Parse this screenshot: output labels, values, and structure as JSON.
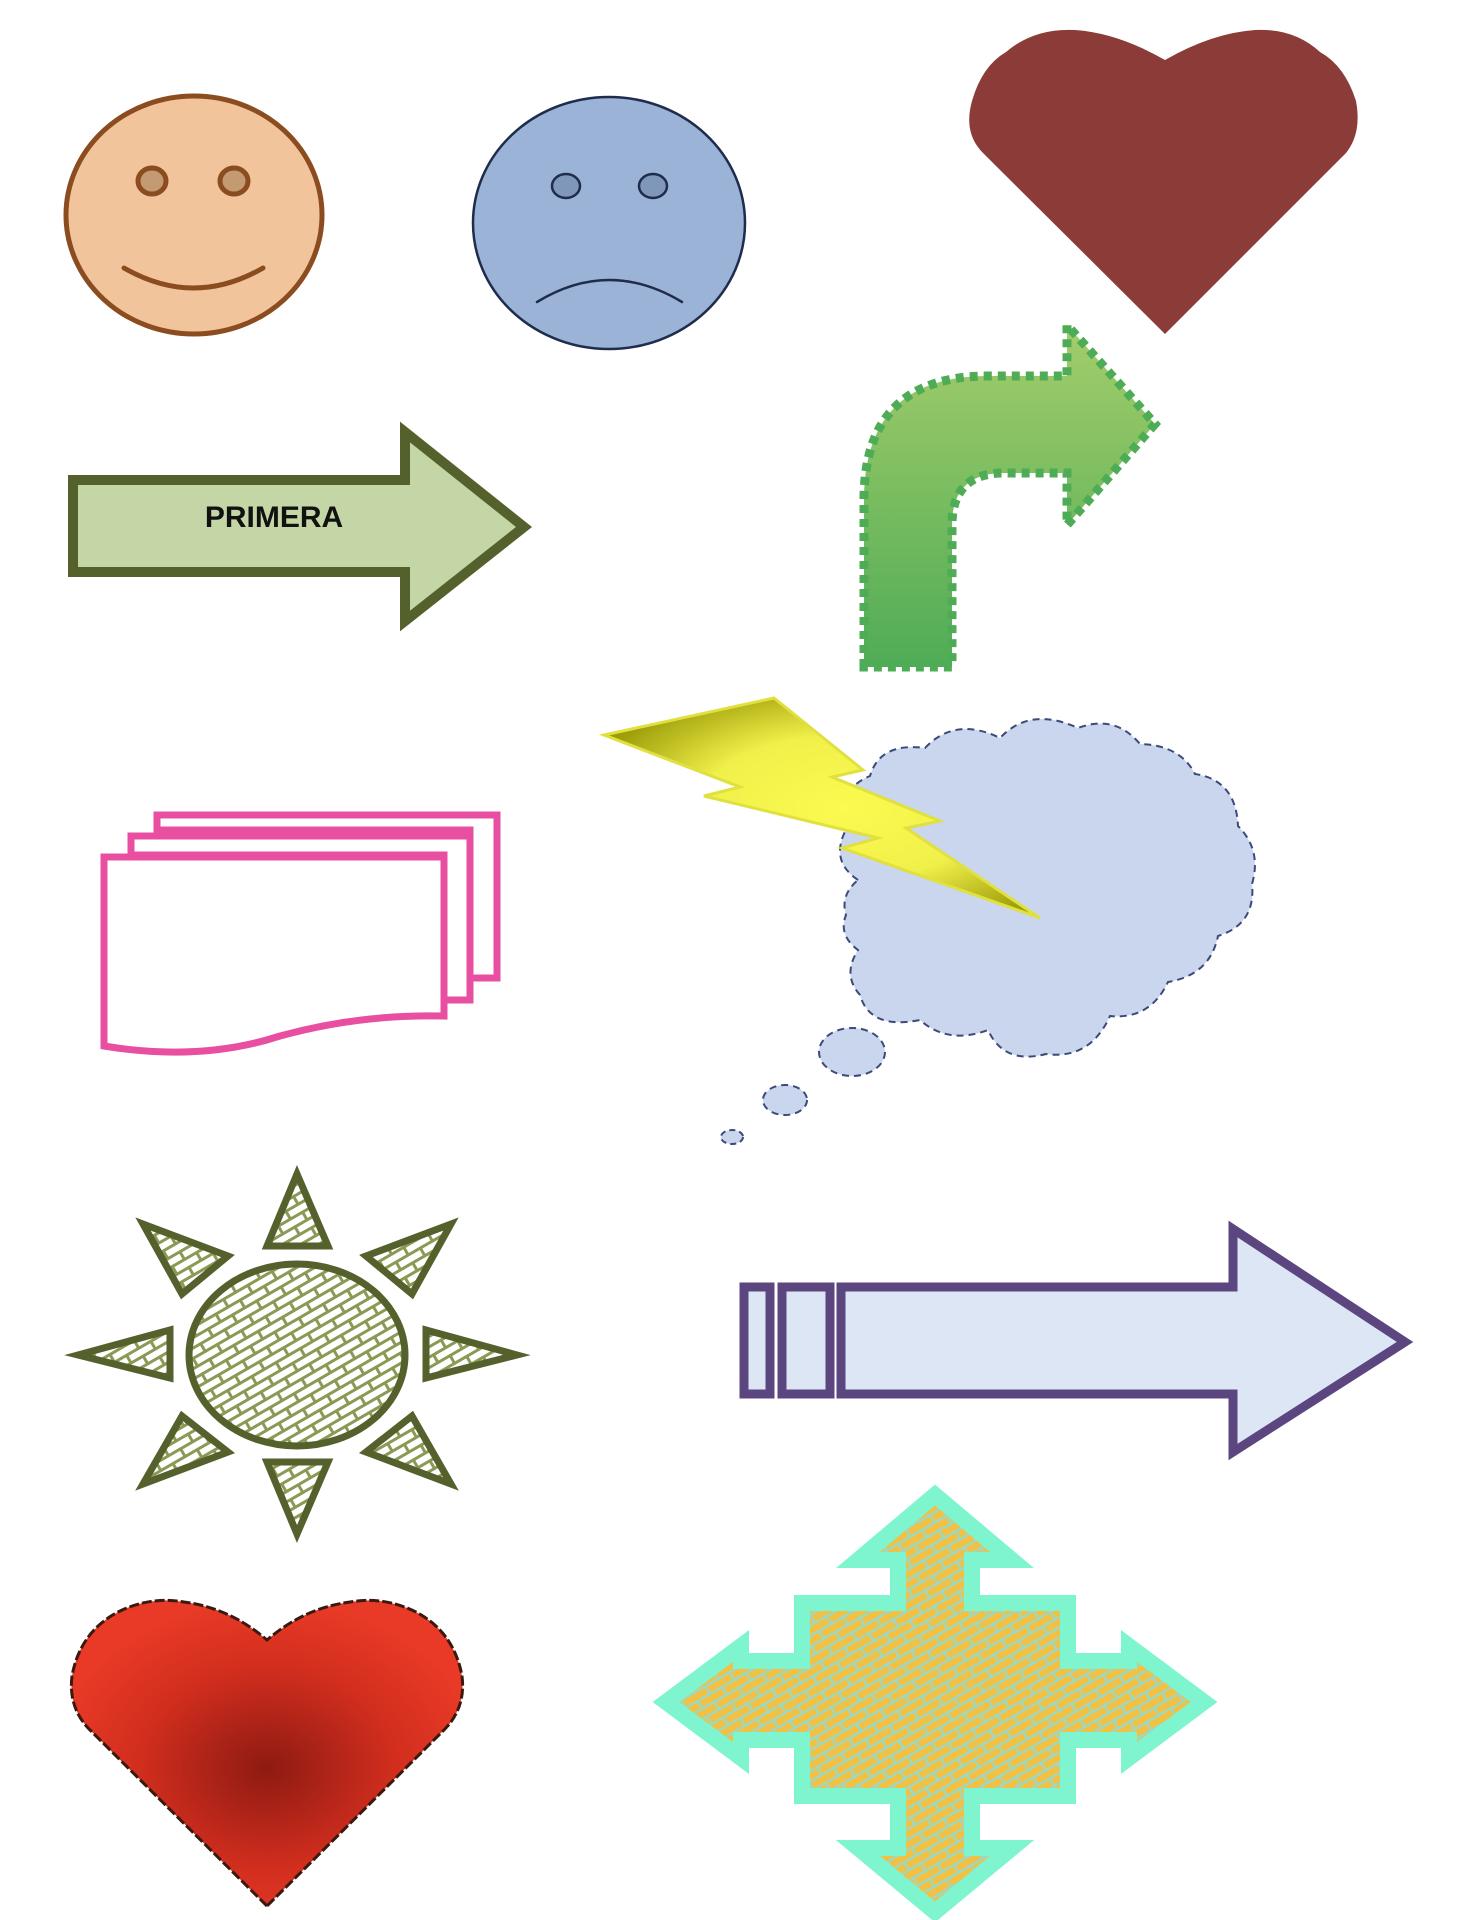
{
  "page": {
    "background": "#ffffff"
  },
  "shapes": {
    "smiley_face": {
      "fill": "#f2c49b",
      "stroke": "#8b4c1f"
    },
    "sad_face": {
      "fill": "#9bb3d6",
      "stroke": "#1f2c4c"
    },
    "heart_dark": {
      "fill": "#8b3c38"
    },
    "block_arrow_right": {
      "label": "PRIMERA",
      "fill": "#c5d6a6",
      "stroke": "#55612d"
    },
    "bent_arrow": {
      "fill_top": "#a4cd6a",
      "fill_bottom": "#4fac56",
      "stroke": "#4fac56"
    },
    "lightning_bolt": {
      "fill_light": "#fafa50",
      "fill_dark": "#b8b80c",
      "stroke": "#e0e040"
    },
    "thought_cloud": {
      "fill": "#c9d6ee",
      "stroke": "#3b4a7a"
    },
    "multidocument": {
      "stroke": "#e84fa0",
      "fill": "#ffffff"
    },
    "sun": {
      "stroke": "#55612d",
      "pattern": "#8a9a55"
    },
    "striped_arrow": {
      "fill": "#dce6f4",
      "stroke": "#5b4680"
    },
    "heart_red": {
      "fill_outer": "#e83a26",
      "fill_center": "#8e1a12",
      "stroke": "#3a1a10"
    },
    "quad_arrow": {
      "fill": "#f2c042",
      "stroke": "#7ff5cf",
      "pattern": "#9fd8c0"
    }
  }
}
